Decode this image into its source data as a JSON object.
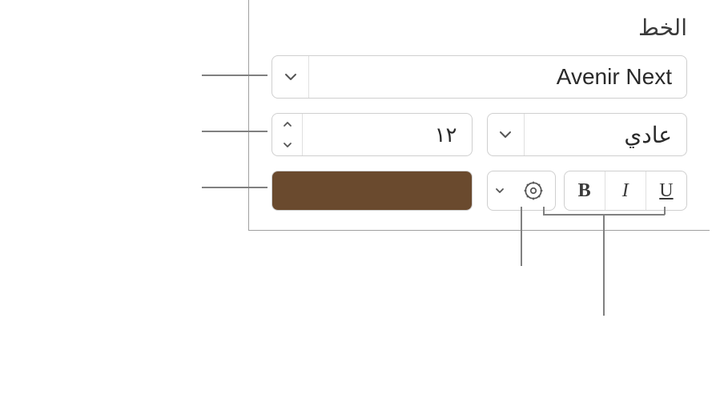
{
  "section": {
    "title": "الخط"
  },
  "font": {
    "family": "Avenir Next",
    "style": "عادي",
    "size": "١٢",
    "color": "#6a4a2e"
  },
  "buttons": {
    "bold": "B",
    "italic": "I",
    "underline": "U"
  }
}
